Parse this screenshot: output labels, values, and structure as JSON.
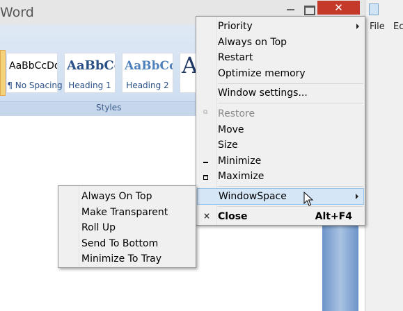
{
  "word_window": {
    "title": "Word",
    "close_glyph": "✕",
    "styles": [
      {
        "sample": "AaBbCcDd",
        "name": "¶ No Spacing"
      },
      {
        "sample": "AaBbCc",
        "name": "Heading 1"
      },
      {
        "sample": "AaBbCc",
        "name": "Heading 2"
      },
      {
        "sample": "A",
        "name": ""
      }
    ],
    "styles_group_label": "Styles"
  },
  "notepad": {
    "menu_file": "File",
    "menu_edit": "Ec"
  },
  "main_menu": {
    "priority": "Priority",
    "always_on_top": "Always on Top",
    "restart": "Restart",
    "optimize_memory": "Optimize memory",
    "window_settings": "Window settings...",
    "restore": "Restore",
    "move": "Move",
    "size": "Size",
    "minimize": "Minimize",
    "maximize": "Maximize",
    "windowspace": "WindowSpace",
    "close": "Close",
    "close_shortcut": "Alt+F4"
  },
  "sub_menu": {
    "always_on_top": "Always On Top",
    "make_transparent": "Make Transparent",
    "roll_up": "Roll Up",
    "send_to_bottom": "Send To Bottom",
    "minimize_to_tray": "Minimize To Tray"
  },
  "icons": {
    "restore": "restore-icon",
    "minimize": "minimize-icon",
    "maximize": "maximize-icon",
    "close": "close-icon",
    "submenu_arrow": "chevron-right-icon",
    "cursor": "mouse-cursor-icon"
  },
  "colors": {
    "close_button": "#c4392a",
    "highlight": "#d5e6f7",
    "highlight_border": "#99c4ec"
  }
}
